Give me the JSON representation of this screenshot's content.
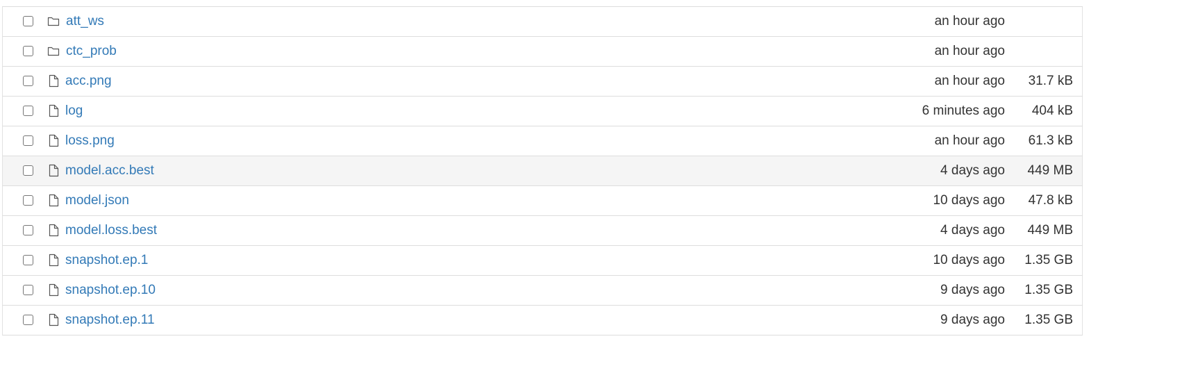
{
  "file_list": {
    "items": [
      {
        "type": "folder",
        "name": "att_ws",
        "modified": "an hour ago",
        "size": ""
      },
      {
        "type": "folder",
        "name": "ctc_prob",
        "modified": "an hour ago",
        "size": ""
      },
      {
        "type": "file",
        "name": "acc.png",
        "modified": "an hour ago",
        "size": "31.7 kB"
      },
      {
        "type": "file",
        "name": "log",
        "modified": "6 minutes ago",
        "size": "404 kB"
      },
      {
        "type": "file",
        "name": "loss.png",
        "modified": "an hour ago",
        "size": "61.3 kB"
      },
      {
        "type": "file",
        "name": "model.acc.best",
        "modified": "4 days ago",
        "size": "449 MB",
        "hovered": true
      },
      {
        "type": "file",
        "name": "model.json",
        "modified": "10 days ago",
        "size": "47.8 kB"
      },
      {
        "type": "file",
        "name": "model.loss.best",
        "modified": "4 days ago",
        "size": "449 MB"
      },
      {
        "type": "file",
        "name": "snapshot.ep.1",
        "modified": "10 days ago",
        "size": "1.35 GB"
      },
      {
        "type": "file",
        "name": "snapshot.ep.10",
        "modified": "9 days ago",
        "size": "1.35 GB"
      },
      {
        "type": "file",
        "name": "snapshot.ep.11",
        "modified": "9 days ago",
        "size": "1.35 GB"
      }
    ]
  },
  "icons": {
    "folder": "folder-icon",
    "file": "file-icon"
  },
  "colors": {
    "link": "#337ab7",
    "text": "#333333",
    "border": "#dddddd",
    "hover_row": "#f5f5f5",
    "icon_stroke": "#555555"
  }
}
